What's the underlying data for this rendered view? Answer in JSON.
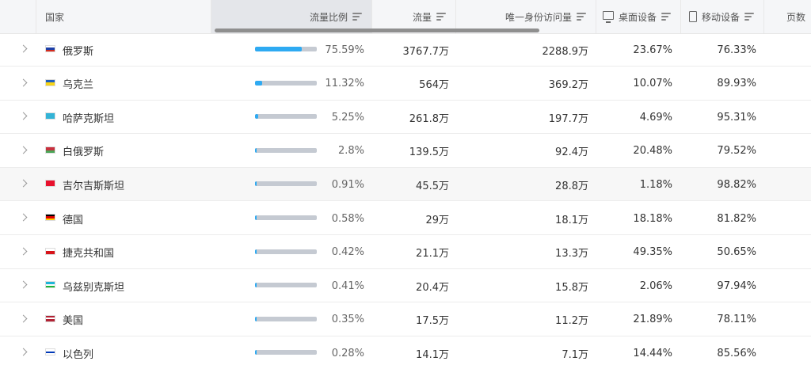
{
  "header": {
    "country": "国家",
    "share": "流量比例",
    "traffic": "流量",
    "unique": "唯一身份访问量",
    "desktop": "桌面设备",
    "mobile": "移动设备",
    "pages": "页数"
  },
  "rows": [
    {
      "country": "俄罗斯",
      "flag": [
        "#ffffff",
        "#1c3fa8",
        "#d52b1e"
      ],
      "flag_dir": "h",
      "share": "75.59%",
      "share_value": 0.7559,
      "traffic": "3767.7万",
      "unique": "2288.9万",
      "desktop": "23.67%",
      "mobile": "76.33%"
    },
    {
      "country": "乌克兰",
      "flag": [
        "#1f5fbf",
        "#f7d417"
      ],
      "flag_dir": "h",
      "share": "11.32%",
      "share_value": 0.1132,
      "traffic": "564万",
      "unique": "369.2万",
      "desktop": "10.07%",
      "mobile": "89.93%"
    },
    {
      "country": "哈萨克斯坦",
      "flag": [
        "#33b3d6",
        "#33b3d6"
      ],
      "flag_dir": "h",
      "share": "5.25%",
      "share_value": 0.0525,
      "traffic": "261.8万",
      "unique": "197.7万",
      "desktop": "4.69%",
      "mobile": "95.31%"
    },
    {
      "country": "白俄罗斯",
      "flag": [
        "#c8313e",
        "#c8313e",
        "#4aa657"
      ],
      "flag_dir": "h",
      "share": "2.8%",
      "share_value": 0.028,
      "traffic": "139.5万",
      "unique": "92.4万",
      "desktop": "20.48%",
      "mobile": "79.52%"
    },
    {
      "country": "吉尔吉斯斯坦",
      "flag": [
        "#e8112d",
        "#e8112d"
      ],
      "flag_dir": "h",
      "share": "0.91%",
      "share_value": 0.0091,
      "traffic": "45.5万",
      "unique": "28.8万",
      "desktop": "1.18%",
      "mobile": "98.82%"
    },
    {
      "country": "德国",
      "flag": [
        "#000000",
        "#dd0000",
        "#ffce00"
      ],
      "flag_dir": "h",
      "share": "0.58%",
      "share_value": 0.0058,
      "traffic": "29万",
      "unique": "18.1万",
      "desktop": "18.18%",
      "mobile": "81.82%"
    },
    {
      "country": "捷克共和国",
      "flag": [
        "#ffffff",
        "#d7141a"
      ],
      "flag_dir": "h",
      "share": "0.42%",
      "share_value": 0.0042,
      "traffic": "21.1万",
      "unique": "13.3万",
      "desktop": "49.35%",
      "mobile": "50.65%"
    },
    {
      "country": "乌兹别克斯坦",
      "flag": [
        "#1eb5d8",
        "#ffffff",
        "#1eb53a"
      ],
      "flag_dir": "h",
      "share": "0.41%",
      "share_value": 0.0041,
      "traffic": "20.4万",
      "unique": "15.8万",
      "desktop": "2.06%",
      "mobile": "97.94%"
    },
    {
      "country": "美国",
      "flag": [
        "#b22234",
        "#ffffff",
        "#b22234"
      ],
      "flag_dir": "h",
      "share": "0.35%",
      "share_value": 0.0035,
      "traffic": "17.5万",
      "unique": "11.2万",
      "desktop": "21.89%",
      "mobile": "78.11%"
    },
    {
      "country": "以色列",
      "flag": [
        "#ffffff",
        "#0038b8",
        "#ffffff"
      ],
      "flag_dir": "h",
      "share": "0.28%",
      "share_value": 0.0028,
      "traffic": "14.1万",
      "unique": "7.1万",
      "desktop": "14.44%",
      "mobile": "85.56%"
    }
  ]
}
